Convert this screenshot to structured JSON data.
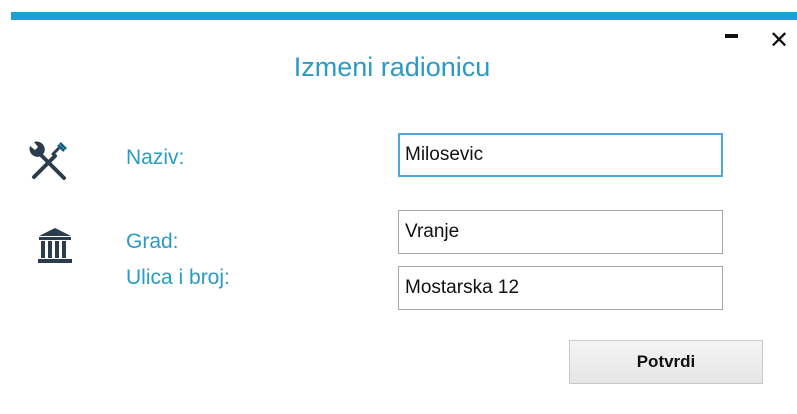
{
  "window": {
    "title": "Izmeni radionicu",
    "accent_color": "#1ba1d8",
    "label_color": "#2a9bc4",
    "controls": {
      "minimize_icon": "minimize-icon",
      "close_icon": "close-icon",
      "close_glyph": "✕"
    }
  },
  "form": {
    "naziv": {
      "label": "Naziv:",
      "value": "Milosevic",
      "icon": "tools-icon"
    },
    "grad": {
      "label": "Grad:",
      "value": "Vranje",
      "icon": "bank-icon"
    },
    "ulica": {
      "label": "Ulica i broj:",
      "value": "Mostarska 12"
    },
    "confirm_label": "Potvrdi"
  }
}
